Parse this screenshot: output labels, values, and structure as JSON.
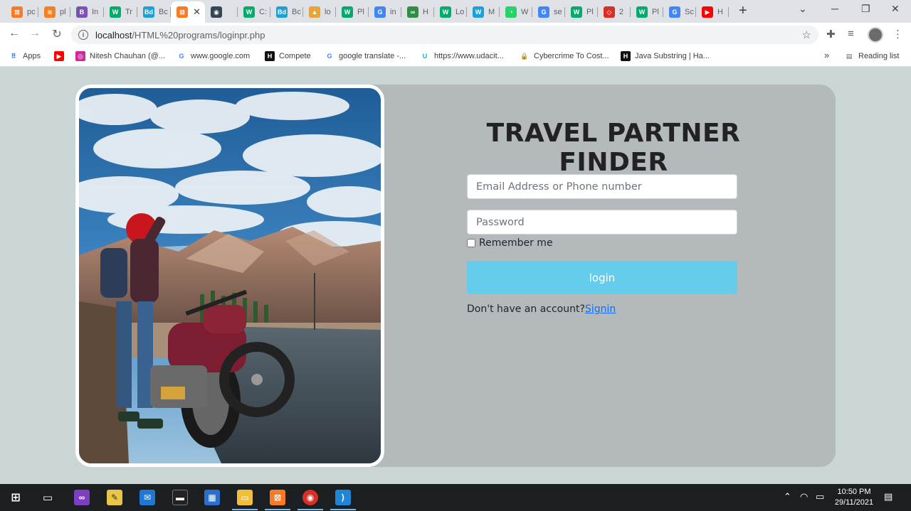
{
  "browser": {
    "tabs": [
      {
        "label": "pc",
        "icon": "xampp-icon",
        "color": "#fb7a24",
        "glyph": "⊠"
      },
      {
        "label": "pl",
        "icon": "stackoverflow-icon",
        "color": "#f48024",
        "glyph": "≋"
      },
      {
        "label": "In",
        "icon": "bootstrap-icon",
        "color": "#7952b3",
        "glyph": "B"
      },
      {
        "label": "Tr",
        "icon": "w3schools-icon",
        "color": "#04aa6d",
        "glyph": "W"
      },
      {
        "label": "Bc",
        "icon": "bd-icon",
        "color": "#1e9fd6",
        "glyph": "Bd"
      },
      {
        "label": "",
        "icon": "xampp-icon",
        "color": "#fb7a24",
        "glyph": "⊠"
      },
      {
        "label": "",
        "icon": "audio-tab-icon",
        "color": "#36454f",
        "glyph": "◉"
      },
      {
        "label": "C:",
        "icon": "w3schools-icon",
        "color": "#04aa6d",
        "glyph": "W"
      },
      {
        "label": "Bc",
        "icon": "bd-icon",
        "color": "#1e9fd6",
        "glyph": "Bd"
      },
      {
        "label": "lo",
        "icon": "hackerrank-icon",
        "color": "#e8a33a",
        "glyph": "▲"
      },
      {
        "label": "Pl",
        "icon": "w3schools-icon",
        "color": "#04aa6d",
        "glyph": "W"
      },
      {
        "label": "in",
        "icon": "google-icon",
        "color": "#4285f4",
        "glyph": "G"
      },
      {
        "label": "H",
        "icon": "geeksforgeeks-icon",
        "color": "#2f8d46",
        "glyph": "∞"
      },
      {
        "label": "Lo",
        "icon": "w3schools-icon",
        "color": "#04aa6d",
        "glyph": "W"
      },
      {
        "label": "M",
        "icon": "w-icon",
        "color": "#1e9fd6",
        "glyph": "W"
      },
      {
        "label": "W",
        "icon": "whatsapp-icon",
        "color": "#25d366",
        "glyph": "◔"
      },
      {
        "label": "se",
        "icon": "google-icon",
        "color": "#4285f4",
        "glyph": "G"
      },
      {
        "label": "Pl",
        "icon": "w3schools-icon",
        "color": "#04aa6d",
        "glyph": "W"
      },
      {
        "label": "2",
        "icon": "cube-icon",
        "color": "#d93025",
        "glyph": "◇"
      },
      {
        "label": "Pl",
        "icon": "w3schools-icon",
        "color": "#04aa6d",
        "glyph": "W"
      },
      {
        "label": "Sc",
        "icon": "google-icon",
        "color": "#4285f4",
        "glyph": "G"
      },
      {
        "label": "H",
        "icon": "youtube-icon",
        "color": "#ff0000",
        "glyph": "▶"
      }
    ],
    "active_tab_close": "✕",
    "new_tab": "+",
    "url_host": "localhost",
    "url_path": "/HTML%20programs/loginpr.php",
    "bookmarks": [
      {
        "label": "Apps",
        "icon": "apps-grid-icon"
      },
      {
        "label": "",
        "icon": "youtube-icon"
      },
      {
        "label": "Nitesh Chauhan (@...",
        "icon": "instagram-icon"
      },
      {
        "label": "www.google.com",
        "icon": "google-icon"
      },
      {
        "label": "Compete",
        "icon": "hackerrank-icon"
      },
      {
        "label": "google translate -...",
        "icon": "google-icon"
      },
      {
        "label": "https://www.udacit...",
        "icon": "udacity-icon"
      },
      {
        "label": "Cybercrime To Cost...",
        "icon": "lock-icon"
      },
      {
        "label": "Java Substring | Ha...",
        "icon": "hackerrank-icon"
      }
    ],
    "bookmarks_more": "»",
    "reading_list": "Reading list"
  },
  "page": {
    "title": "TRAVEL PARTNER FINDER",
    "email_placeholder": "Email Address or Phone number",
    "password_placeholder": "Password",
    "remember_label": "Remember me",
    "login_label": "login",
    "account_text": "Don't have an account?",
    "signin_link": "Signin"
  },
  "taskbar": {
    "time": "10:50 PM",
    "date": "29/11/2021"
  },
  "colors": {
    "page_bg": "#c9d6d5",
    "card_bg": "#b4b9bc",
    "login_button": "#66ccec",
    "link": "#0d6efd"
  }
}
